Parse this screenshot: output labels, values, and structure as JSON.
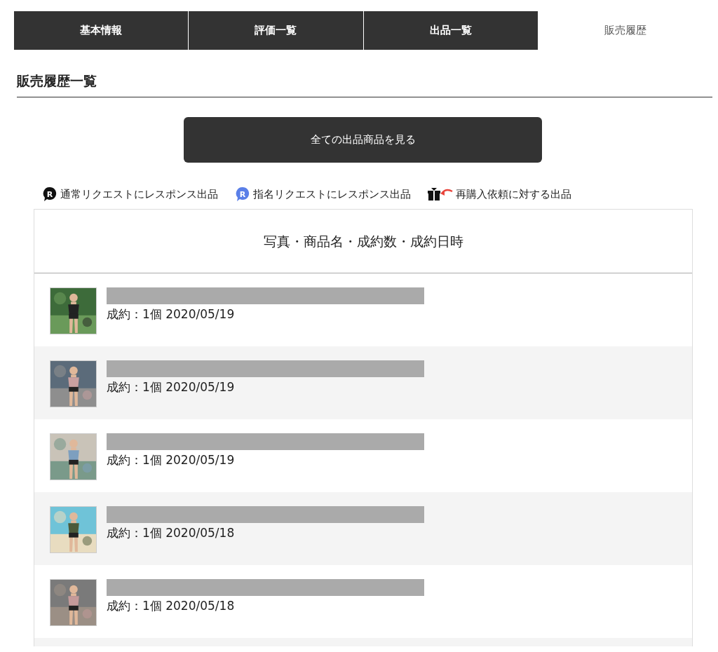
{
  "tabs": [
    {
      "label": "基本情報",
      "selected": false
    },
    {
      "label": "評価一覧",
      "selected": false
    },
    {
      "label": "出品一覧",
      "selected": false
    },
    {
      "label": "販売履歴",
      "selected": true
    }
  ],
  "section_title": "販売履歴一覧",
  "view_all_button": "全ての出品商品を見る",
  "legend": [
    {
      "kind": "normal",
      "icon_letter": "R",
      "label": "通常リクエストにレスポンス出品"
    },
    {
      "kind": "named",
      "icon_letter": "R",
      "label": "指名リクエストにレスポンス出品"
    },
    {
      "kind": "repurchase",
      "label": "再購入依頼に対する出品"
    }
  ],
  "table": {
    "header": "写真・商品名・成約数・成約日時",
    "rows": [
      {
        "detail": "成約：1個 2020/05/19"
      },
      {
        "detail": "成約：1個 2020/05/19"
      },
      {
        "detail": "成約：1個 2020/05/19"
      },
      {
        "detail": "成約：1個 2020/05/18"
      },
      {
        "detail": "成約：1個 2020/05/18"
      }
    ]
  }
}
